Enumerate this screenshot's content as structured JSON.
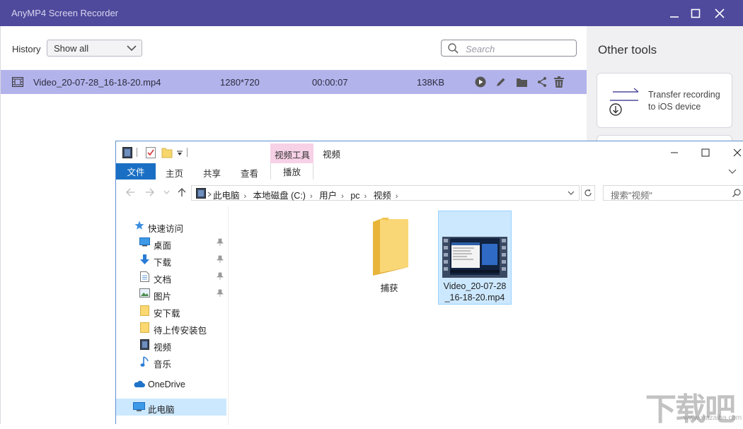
{
  "app": {
    "title": "AnyMP4 Screen Recorder",
    "history_label": "History",
    "history_filter": "Show all",
    "search_placeholder": "Search",
    "recording": {
      "name": "Video_20-07-28_16-18-20.mp4",
      "resolution": "1280*720",
      "duration": "00:00:07",
      "size": "138KB",
      "actions": [
        "play-icon",
        "edit-icon",
        "folder-icon",
        "share-icon",
        "delete-icon"
      ]
    },
    "side": {
      "title": "Other tools",
      "tool1_line1": "Transfer recording",
      "tool1_line2": "to iOS device"
    },
    "colors": {
      "titlebar": "#4f4a9c",
      "row_selected": "#b3b3ec"
    }
  },
  "explorer": {
    "context_tab": "视频工具",
    "window_title": "视频",
    "ribbon": {
      "file": "文件",
      "home": "主页",
      "share": "共享",
      "view": "查看",
      "play": "播放"
    },
    "breadcrumb": [
      "此电脑",
      "本地磁盘 (C:)",
      "用户",
      "pc",
      "视频"
    ],
    "search_placeholder": "搜索\"视频\"",
    "nav": {
      "quick_access": "快速访问",
      "desktop": "桌面",
      "downloads": "下载",
      "documents": "文档",
      "pictures": "图片",
      "an_download": "安下载",
      "pending": "待上传安装包",
      "videos": "视频",
      "music": "音乐",
      "onedrive": "OneDrive",
      "this_pc": "此电脑"
    },
    "items": {
      "folder_name": "捕获",
      "file_name_line1": "Video_20-07-28",
      "file_name_line2": "_16-18-20.mp4"
    }
  },
  "watermark": {
    "main": "下载吧",
    "sub": "www.xiazaiba.com"
  }
}
